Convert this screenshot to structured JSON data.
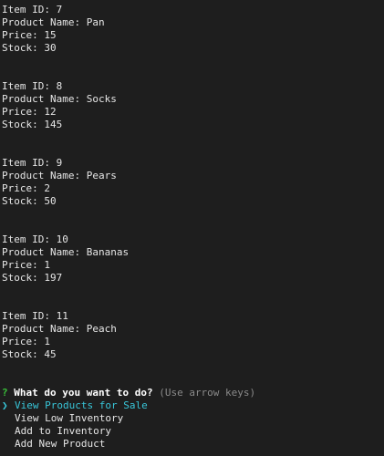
{
  "terminal": {
    "items": [
      {
        "id_line": "Item ID: 7",
        "name_line": "Product Name: Pan",
        "price_line": "Price: 15",
        "stock_line": "Stock: 30"
      },
      {
        "id_line": "Item ID: 8",
        "name_line": "Product Name: Socks",
        "price_line": "Price: 12",
        "stock_line": "Stock: 145"
      },
      {
        "id_line": "Item ID: 9",
        "name_line": "Product Name: Pears",
        "price_line": "Price: 2",
        "stock_line": "Stock: 50"
      },
      {
        "id_line": "Item ID: 10",
        "name_line": "Product Name: Bananas",
        "price_line": "Price: 1",
        "stock_line": "Stock: 197"
      },
      {
        "id_line": "Item ID: 11",
        "name_line": "Product Name: Peach",
        "price_line": "Price: 1",
        "stock_line": "Stock: 45"
      }
    ],
    "prompt": {
      "mark": "?",
      "question": "What do you want to do?",
      "hint": "(Use arrow keys)",
      "pointer": "❯",
      "options": [
        {
          "label": "View Products for Sale",
          "selected": true
        },
        {
          "label": "View Low Inventory",
          "selected": false
        },
        {
          "label": "Add to Inventory",
          "selected": false
        },
        {
          "label": "Add New Product",
          "selected": false
        }
      ]
    },
    "colors": {
      "background": "#1e1e1e",
      "text": "#e6e6e6",
      "prompt_mark": "#39c039",
      "hint": "#8a8a8a",
      "selected": "#38c6d9"
    }
  }
}
